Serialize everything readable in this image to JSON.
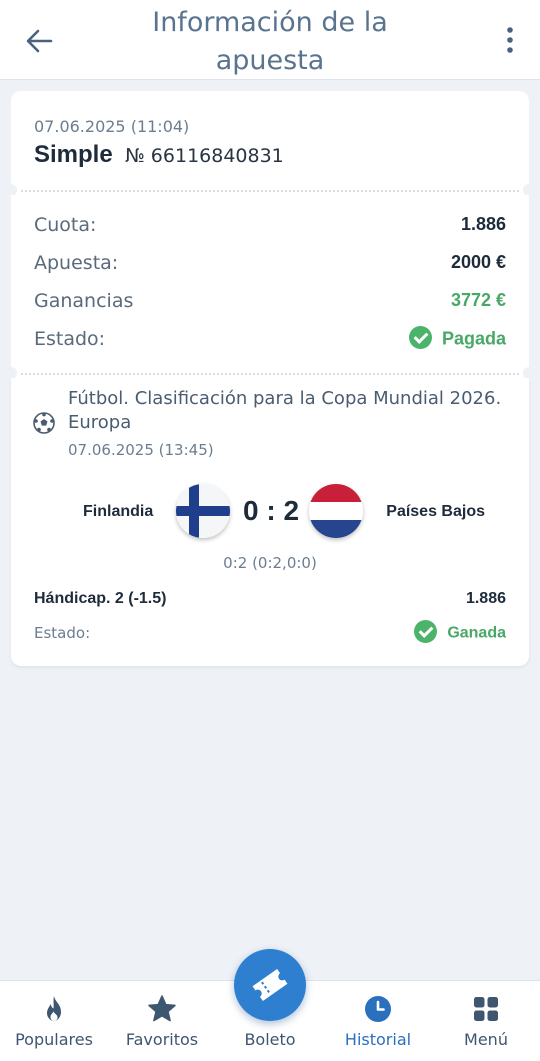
{
  "header": {
    "title": "Información de la apuesta",
    "back_icon": "arrow-left-icon",
    "menu_icon": "more-vertical-icon"
  },
  "bet": {
    "datetime": "07.06.2025 (11:04)",
    "type": "Simple",
    "number": "№ 66116840831",
    "rows": [
      {
        "label": "Cuota:",
        "value": "1.886"
      },
      {
        "label": "Apuesta:",
        "value": "2000 €"
      },
      {
        "label": "Ganancias",
        "value": "3772 €"
      },
      {
        "label": "Estado:",
        "value": "Pagada"
      }
    ]
  },
  "event": {
    "sport_icon": "soccer-ball-icon",
    "league": "Fútbol. Clasificación para la Copa Mundial 2026. Europa",
    "datetime": "07.06.2025 (13:45)",
    "home_team": "Finlandia",
    "away_team": "Países Bajos",
    "score": "0 : 2",
    "subscore": "0:2 (0:2,0:0)",
    "market": "Hándicap. 2 (-1.5)",
    "odd": "1.886",
    "status_label": "Estado:",
    "status_value": "Ganada"
  },
  "nav": {
    "items": [
      {
        "label": "Populares",
        "icon": "flame-icon"
      },
      {
        "label": "Favoritos",
        "icon": "star-icon"
      },
      {
        "label": "Boleto",
        "icon": "ticket-icon"
      },
      {
        "label": "Historial",
        "icon": "clock-icon"
      },
      {
        "label": "Menú",
        "icon": "grid-icon"
      }
    ],
    "active": "Historial"
  },
  "colors": {
    "accent": "#2f7fd0",
    "success": "#4cb36a",
    "title": "#5a7490"
  }
}
